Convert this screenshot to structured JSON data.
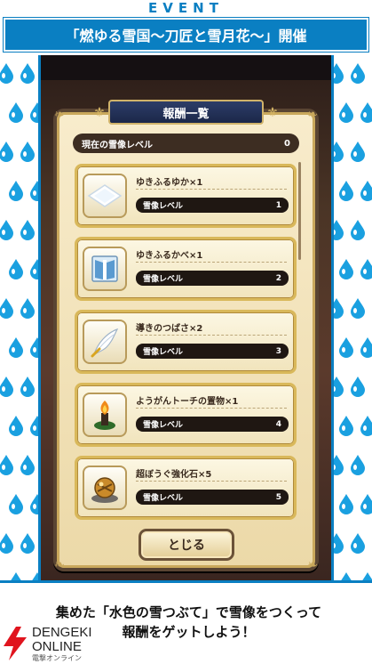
{
  "header": {
    "event_label": "EVENT",
    "title": "「燃ゆる雪国～刀匠と雪月花～」開催"
  },
  "modal": {
    "title": "報酬一覧",
    "current_level_label": "現在の雪像レベル",
    "current_level_value": "0",
    "close_label": "とじる"
  },
  "rewards": [
    {
      "name": "ゆきふるゆか×1",
      "req_label": "雪像レベル",
      "req_value": "1",
      "icon": "snow-floor-icon"
    },
    {
      "name": "ゆきふるかべ×1",
      "req_label": "雪像レベル",
      "req_value": "2",
      "icon": "snow-wall-icon"
    },
    {
      "name": "導きのつばさ×2",
      "req_label": "雪像レベル",
      "req_value": "3",
      "icon": "wing-icon"
    },
    {
      "name": "ようがんトーチの置物×1",
      "req_label": "雪像レベル",
      "req_value": "4",
      "icon": "lava-torch-icon"
    },
    {
      "name": "超ぼうぐ強化石×5",
      "req_label": "雪像レベル",
      "req_value": "5",
      "icon": "armor-stone-icon"
    }
  ],
  "caption": {
    "line1": "集めた「水色の雪つぶて」で雪像をつくって",
    "line2": "報酬をゲットしよう！"
  },
  "logo": {
    "line1": "DENGEKI",
    "line2": "ONLINE",
    "line3": "電撃オンライン"
  },
  "colors": {
    "accent": "#0a7fc2",
    "modal_header": "#1b2749",
    "gold": "#d9b85a"
  }
}
